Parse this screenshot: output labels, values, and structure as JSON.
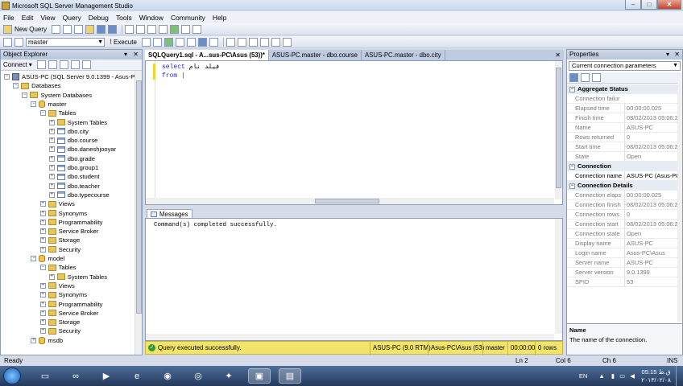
{
  "window": {
    "title": "Microsoft SQL Server Management Studio",
    "min": "–",
    "max": "□",
    "close": "✕"
  },
  "menu": [
    "File",
    "Edit",
    "View",
    "Query",
    "Debug",
    "Tools",
    "Window",
    "Community",
    "Help"
  ],
  "toolbar": {
    "new_query": "New Query",
    "database": "master",
    "execute": "Execute"
  },
  "object_explorer": {
    "title": "Object Explorer",
    "connect": "Connect",
    "tree": [
      {
        "label": "ASUS-PC (SQL Server 9.0.1399 - Asus-PC\\A",
        "level": 0,
        "icon": "server",
        "expand": "−"
      },
      {
        "label": "Databases",
        "level": 1,
        "icon": "folder",
        "expand": "−"
      },
      {
        "label": "System Databases",
        "level": 2,
        "icon": "folder",
        "expand": "−"
      },
      {
        "label": "master",
        "level": 3,
        "icon": "db",
        "expand": "−"
      },
      {
        "label": "Tables",
        "level": 4,
        "icon": "folder",
        "expand": "−"
      },
      {
        "label": "System Tables",
        "level": 5,
        "icon": "folder",
        "expand": "+"
      },
      {
        "label": "dbo.city",
        "level": 5,
        "icon": "table",
        "expand": "+"
      },
      {
        "label": "dbo.course",
        "level": 5,
        "icon": "table",
        "expand": "+"
      },
      {
        "label": "dbo.daneshjooyar",
        "level": 5,
        "icon": "table",
        "expand": "+"
      },
      {
        "label": "dbo.grade",
        "level": 5,
        "icon": "table",
        "expand": "+"
      },
      {
        "label": "dbo.group1",
        "level": 5,
        "icon": "table",
        "expand": "+"
      },
      {
        "label": "dbo.student",
        "level": 5,
        "icon": "table",
        "expand": "+"
      },
      {
        "label": "dbo.teacher",
        "level": 5,
        "icon": "table",
        "expand": "+"
      },
      {
        "label": "dbo.typecourse",
        "level": 5,
        "icon": "table",
        "expand": "+"
      },
      {
        "label": "Views",
        "level": 4,
        "icon": "folder",
        "expand": "+"
      },
      {
        "label": "Synonyms",
        "level": 4,
        "icon": "folder",
        "expand": "+"
      },
      {
        "label": "Programmability",
        "level": 4,
        "icon": "folder",
        "expand": "+"
      },
      {
        "label": "Service Broker",
        "level": 4,
        "icon": "folder",
        "expand": "+"
      },
      {
        "label": "Storage",
        "level": 4,
        "icon": "folder",
        "expand": "+"
      },
      {
        "label": "Security",
        "level": 4,
        "icon": "folder",
        "expand": "+"
      },
      {
        "label": "model",
        "level": 3,
        "icon": "db",
        "expand": "−"
      },
      {
        "label": "Tables",
        "level": 4,
        "icon": "folder",
        "expand": "−"
      },
      {
        "label": "System Tables",
        "level": 5,
        "icon": "folder",
        "expand": "+"
      },
      {
        "label": "Views",
        "level": 4,
        "icon": "folder",
        "expand": "+"
      },
      {
        "label": "Synonyms",
        "level": 4,
        "icon": "folder",
        "expand": "+"
      },
      {
        "label": "Programmability",
        "level": 4,
        "icon": "folder",
        "expand": "+"
      },
      {
        "label": "Service Broker",
        "level": 4,
        "icon": "folder",
        "expand": "+"
      },
      {
        "label": "Storage",
        "level": 4,
        "icon": "folder",
        "expand": "+"
      },
      {
        "label": "Security",
        "level": 4,
        "icon": "folder",
        "expand": "+"
      },
      {
        "label": "msdb",
        "level": 3,
        "icon": "db",
        "expand": "+"
      }
    ]
  },
  "tabs": [
    {
      "label": "SQLQuery1.sql - A...sus-PC\\Asus (53))*",
      "active": true
    },
    {
      "label": "ASUS-PC.master - dbo.course",
      "active": false
    },
    {
      "label": "ASUS-PC.master - dbo.city",
      "active": false
    }
  ],
  "editor": {
    "line1_kw": "select ",
    "line1_ar": "فيلد نام",
    "line2": "from |"
  },
  "results": {
    "tab": "Messages",
    "message": "Command(s) completed successfully.",
    "status": "Query executed successfully.",
    "server": "ASUS-PC (9.0 RTM)",
    "user": "Asus-PC\\Asus (53)",
    "db": "master",
    "time": "00:00:00",
    "rows": "0 rows"
  },
  "properties": {
    "title": "Properties",
    "combo": "Current connection parameters",
    "cat1": "Aggregate Status",
    "group1": [
      [
        "Connection failur",
        ""
      ],
      [
        "Elapsed time",
        "00:00:00.025"
      ],
      [
        "Finish time",
        "08/02/2013 05:06:26 ك"
      ],
      [
        "Name",
        "ASUS-PC"
      ],
      [
        "Rows returned",
        "0"
      ],
      [
        "Start time",
        "08/02/2013 05:06:26 ك"
      ],
      [
        "State",
        "Open"
      ]
    ],
    "cat2": "Connection",
    "conn_name_k": "Connection name",
    "conn_name_v": "ASUS-PC (Asus-PC\\As",
    "cat3": "Connection Details",
    "group3": [
      [
        "Connection elaps",
        "00:00:00.025"
      ],
      [
        "Connection finish",
        "08/02/2013 05:06:26 ك"
      ],
      [
        "Connection rows",
        "0"
      ],
      [
        "Connection start",
        "08/02/2013 05:06:26 ك"
      ],
      [
        "Connection state",
        "Open"
      ],
      [
        "Display name",
        "ASUS-PC"
      ],
      [
        "Login name",
        "Asus-PC\\Asus"
      ],
      [
        "Server name",
        "ASUS-PC"
      ],
      [
        "Server version",
        "9.0.1399"
      ],
      [
        "SPID",
        "53"
      ]
    ],
    "desc_name": "Name",
    "desc_text": "The name of the connection."
  },
  "statusbar": {
    "ready": "Ready",
    "ln": "Ln 2",
    "col": "Col 6",
    "ch": "Ch 6",
    "ins": "INS"
  },
  "taskbar": {
    "lang": "EN",
    "time": "05:15 ق.ظ",
    "date": "۲۰۱۳/۰۲/۰۸"
  }
}
